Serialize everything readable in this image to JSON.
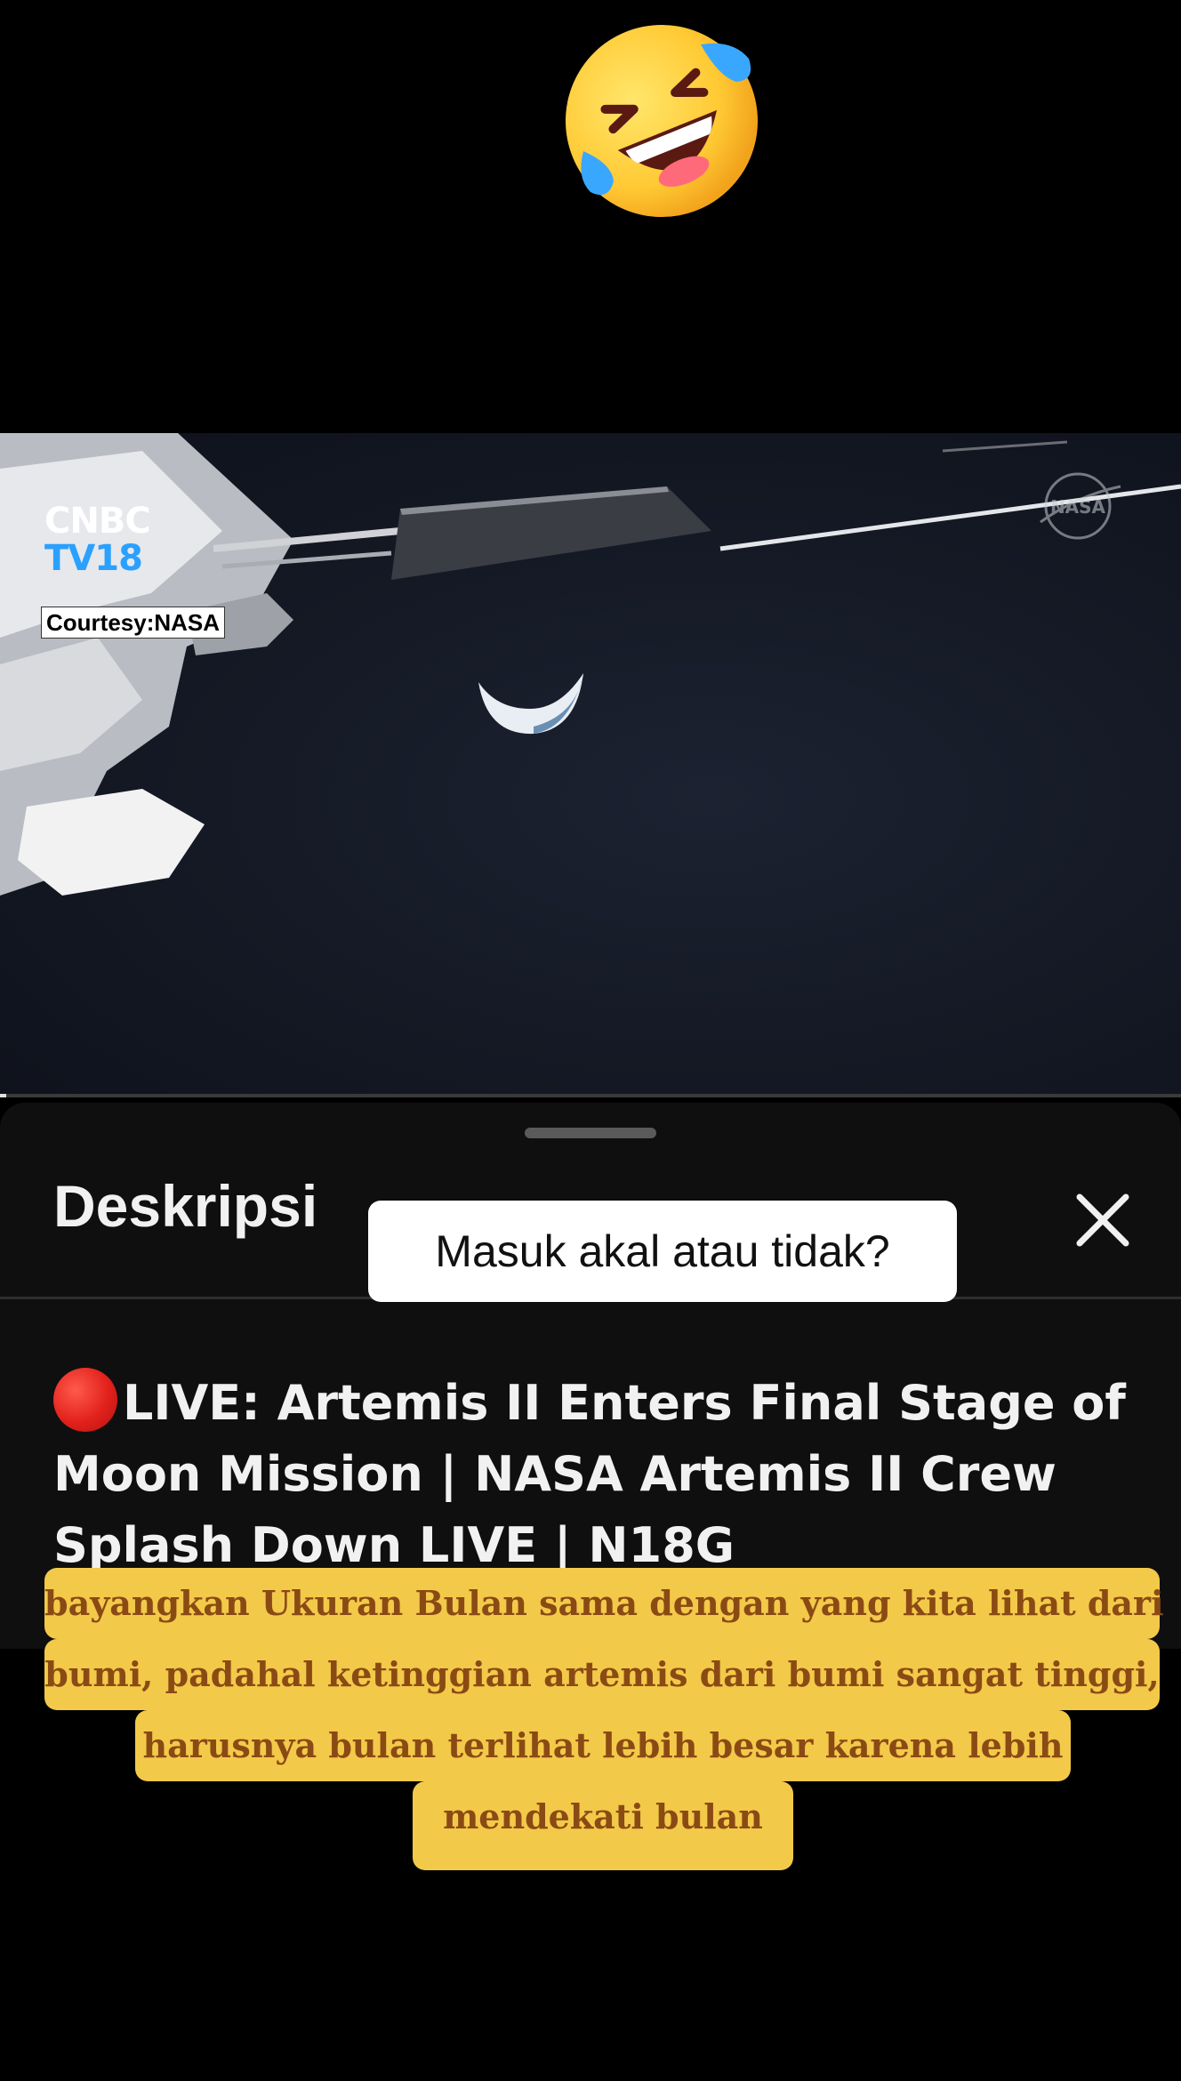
{
  "emoji": {
    "icon": "rolling-on-the-floor-laughing-emoji"
  },
  "video": {
    "channel_logo_line1": "CNBC",
    "channel_logo_line2": "TV18",
    "courtesy": "Courtesy:NASA",
    "watermark_icon": "nasa-meatball-logo",
    "progress": 0.005
  },
  "sheet": {
    "title": "Deskripsi",
    "close_icon": "close-icon",
    "video_title": "LIVE: Artemis II Enters Final Stage of Moon Mission | NASA Artemis II Crew Splash Down LIVE | N18G",
    "live_icon": "red-circle-icon"
  },
  "overlay": {
    "question": "Masuk akal atau tidak?",
    "caption_lines": [
      "bayangkan Ukuran Bulan sama dengan yang kita lihat dari",
      "bumi, padahal ketinggian artemis dari bumi sangat tinggi,",
      "harusnya bulan terlihat lebih besar karena lebih",
      "mendekati bulan"
    ]
  },
  "colors": {
    "background": "#000000",
    "sheet": "#0f0f0f",
    "caption_bg": "#f3c949",
    "caption_text": "#8a4a14",
    "cnbc_blue": "#2aa0ff"
  }
}
